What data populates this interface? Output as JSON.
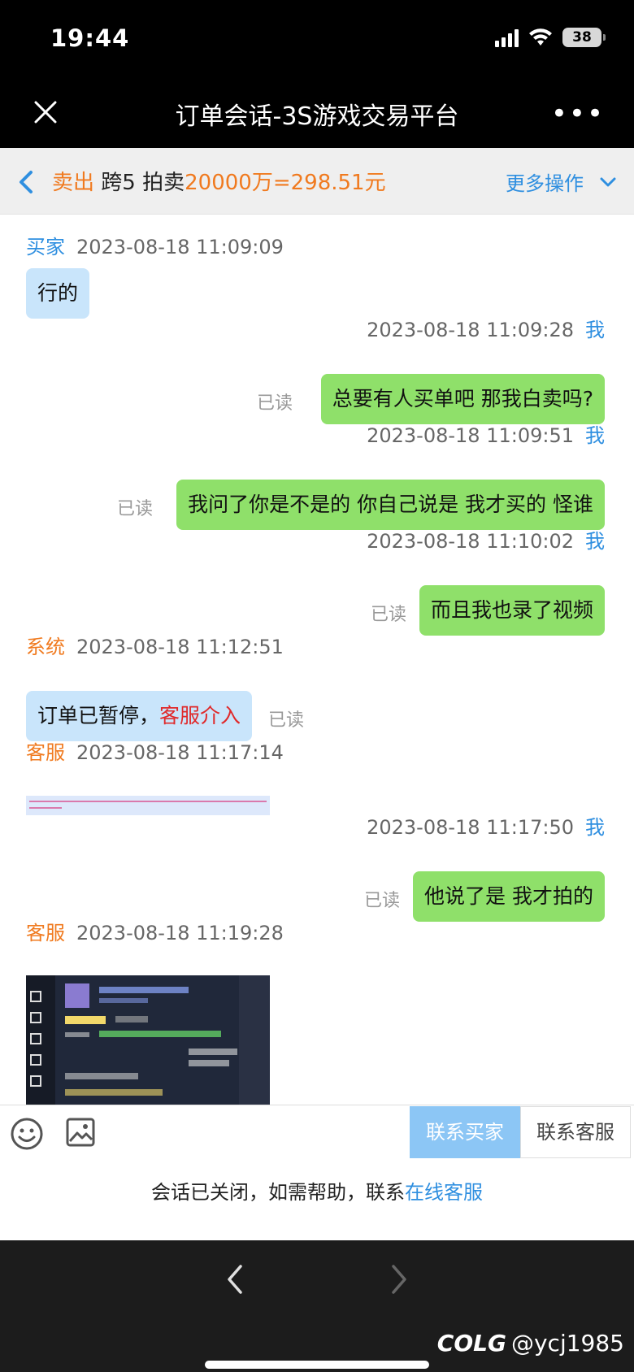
{
  "status_bar": {
    "time": "19:44",
    "battery": "38"
  },
  "title_bar": {
    "title": "订单会话-3S游戏交易平台",
    "more": "•••"
  },
  "order_header": {
    "type": "卖出",
    "server": "跨5",
    "mode": "拍卖",
    "price": "20000万=298.51元",
    "more_actions": "更多操作"
  },
  "messages": [
    {
      "role": "买家",
      "time": "2023-08-18 11:09:09",
      "text": "行的"
    },
    {
      "role": "我",
      "time": "2023-08-18 11:09:28",
      "text": "总要有人买单吧 那我白卖吗?",
      "status": "已读"
    },
    {
      "role": "我",
      "time": "2023-08-18 11:09:51",
      "text": "我问了你是不是的 你自己说是 我才买的 怪谁",
      "status": "已读"
    },
    {
      "role": "我",
      "time": "2023-08-18 11:10:02",
      "text": "而且我也录了视频",
      "status": "已读"
    },
    {
      "role": "系统",
      "time": "2023-08-18 11:12:51",
      "text": "订单已暂停，",
      "highlight": "客服介入",
      "status": "已读"
    },
    {
      "role": "客服",
      "time": "2023-08-18 11:17:14"
    },
    {
      "role": "我",
      "time": "2023-08-18 11:17:50",
      "text": "他说了是 我才拍的",
      "status": "已读"
    },
    {
      "role": "客服",
      "time": "2023-08-18 11:19:28"
    }
  ],
  "input_bar": {
    "contact_buyer": "联系买家",
    "contact_service": "联系客服"
  },
  "closed_notice": {
    "text": "会话已关闭，如需帮助，联系",
    "link": "在线客服"
  },
  "watermark": {
    "brand": "COLG",
    "user": "@ycj1985"
  },
  "colors": {
    "accent_blue": "#2f8fe0",
    "orange": "#f07a1f",
    "me_bubble": "#8fe06a",
    "other_bubble": "#c9e5fb"
  }
}
